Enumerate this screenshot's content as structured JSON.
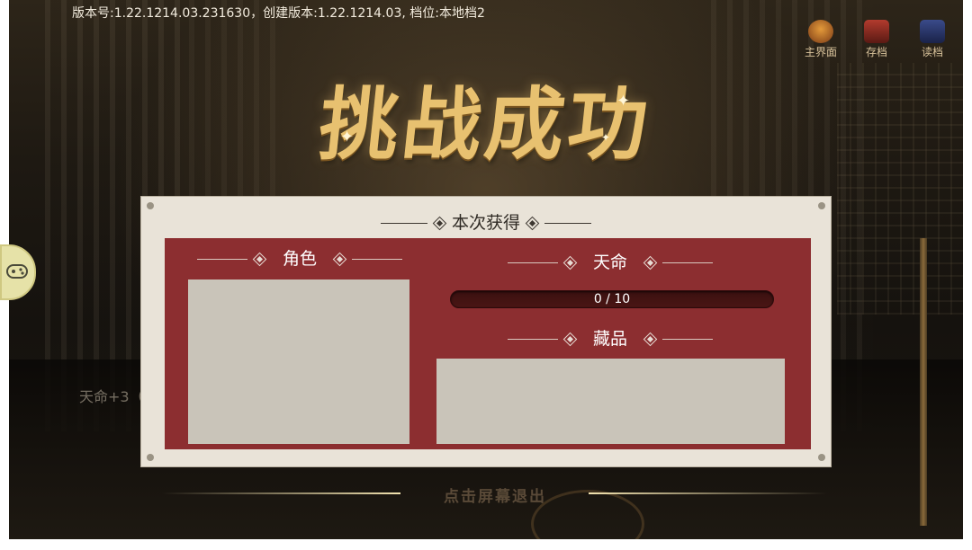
{
  "version_info": "版本号:1.22.1214.03.231630，创建版本:1.22.1214.03, 档位:本地档2",
  "top_buttons": [
    {
      "label": "主界面",
      "icon": "home-icon"
    },
    {
      "label": "存档",
      "icon": "save-icon"
    },
    {
      "label": "读档",
      "icon": "load-icon"
    }
  ],
  "title": "挑战成功",
  "background_text": "天命+3（",
  "panel": {
    "title": "本次获得",
    "role": {
      "title": "角色"
    },
    "fate": {
      "title": "天命",
      "progress_text": "0 / 10",
      "current": 0,
      "max": 10
    },
    "treasure": {
      "title": "藏品"
    }
  },
  "exit_hint": "点击屏幕退出",
  "colors": {
    "panel_bg": "#e9e3d8",
    "inner_bg": "#8c2e30",
    "slot_bg": "#c9c4b9",
    "title_gold": "#e8c170"
  }
}
